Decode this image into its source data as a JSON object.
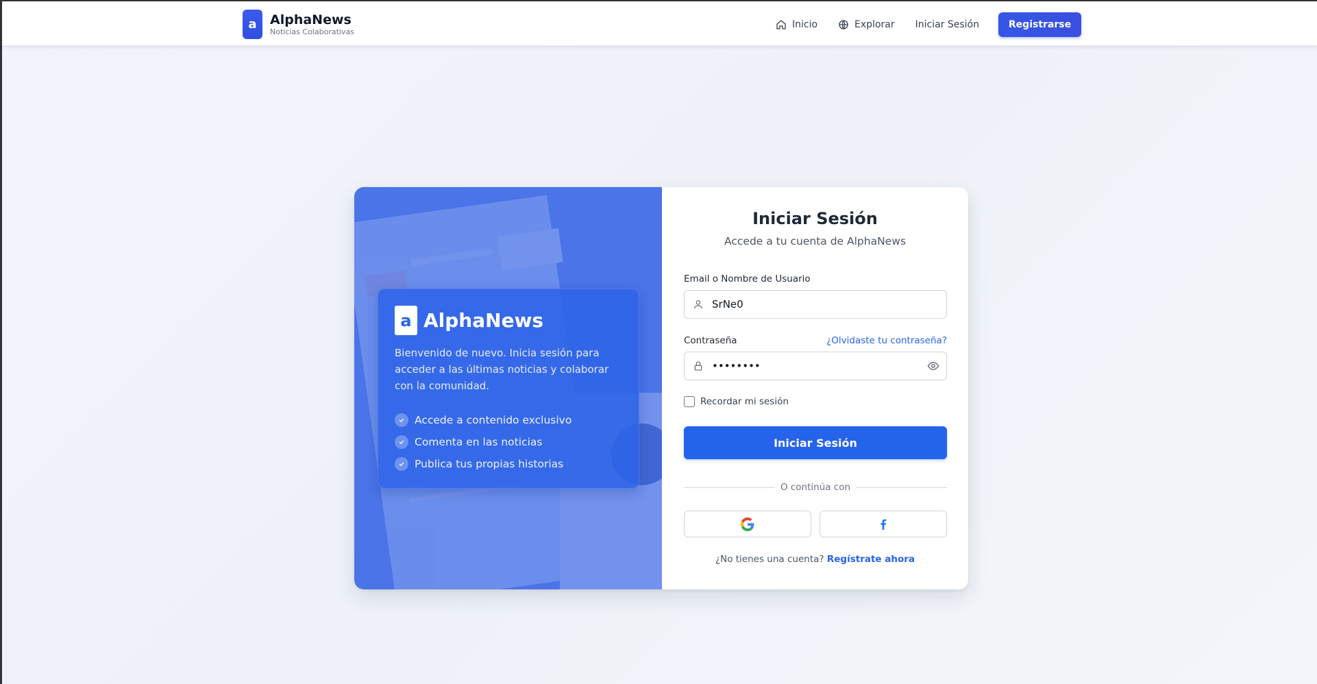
{
  "header": {
    "brand_letter": "a",
    "brand_name": "AlphaNews",
    "brand_subtitle": "Noticias Colaborativas",
    "nav": {
      "home": "Inicio",
      "explore": "Explorar",
      "login": "Iniciar Sesión",
      "register": "Registrarse"
    }
  },
  "promo": {
    "brand_letter": "a",
    "brand_name": "AlphaNews",
    "description": "Bienvenido de nuevo. Inicia sesión para acceder a las últimas noticias y colaborar con la comunidad.",
    "features": [
      "Accede a contenido exclusivo",
      "Comenta en las noticias",
      "Publica tus propias historias"
    ]
  },
  "login_form": {
    "title": "Iniciar Sesión",
    "subtitle": "Accede a tu cuenta de AlphaNews",
    "email_label": "Email o Nombre de Usuario",
    "email_value": "SrNe0",
    "password_label": "Contraseña",
    "forgot_link": "¿Olvidaste tu contraseña?",
    "password_value": "••••••••",
    "remember_label": "Recordar mi sesión",
    "remember_checked": false,
    "submit_label": "Iniciar Sesión",
    "divider_text": "O continúa con",
    "social": [
      "google-icon",
      "facebook-icon"
    ],
    "signup_prompt": "¿No tienes una cuenta?",
    "signup_link": "Regístrate ahora"
  },
  "colors": {
    "primary": "#2563eb",
    "promo_bg": "#4a74e8",
    "page_bg": "#f1f4fa"
  }
}
